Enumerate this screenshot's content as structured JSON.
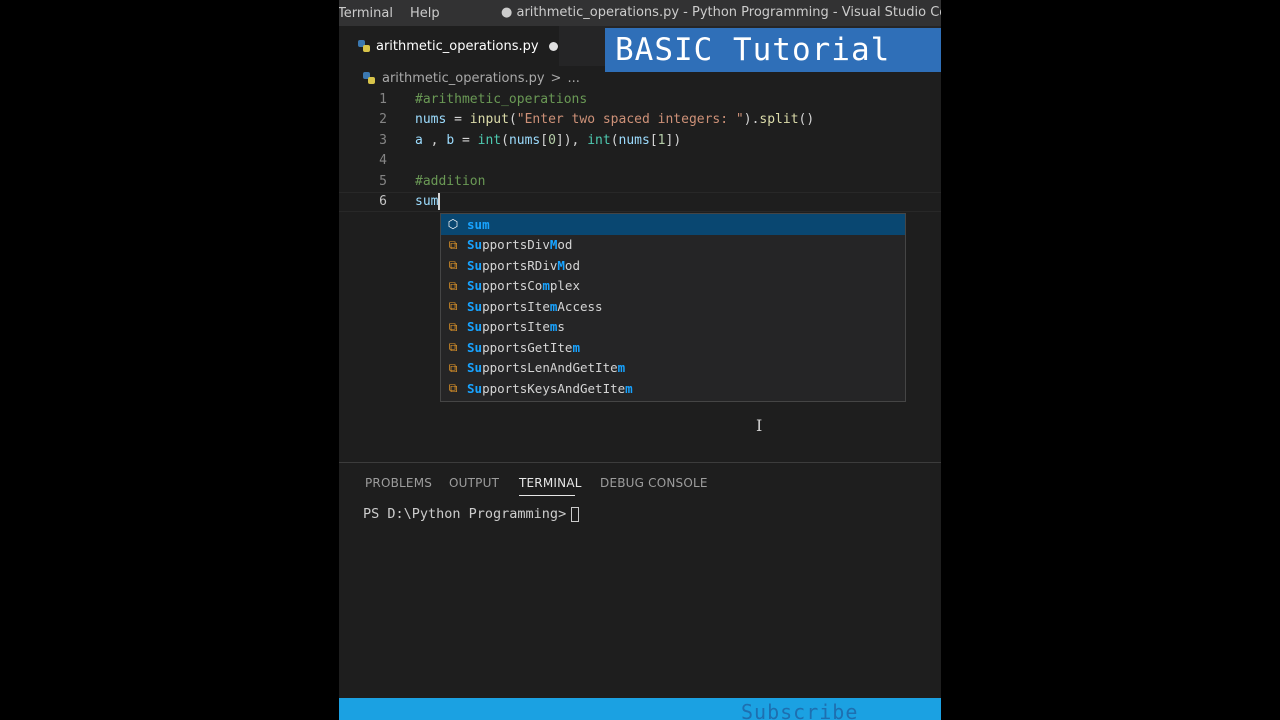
{
  "titlebar": {
    "menu_terminal": "Terminal",
    "menu_help": "Help",
    "window_title": "● arithmetic_operations.py - Python Programming - Visual Studio Code"
  },
  "tab": {
    "filename": "arithmetic_operations.py",
    "icon": "python-file-icon",
    "modified": true
  },
  "banner": {
    "text": "BASIC Tutorial"
  },
  "breadcrumb": {
    "file": "arithmetic_operations.py",
    "separator": ">",
    "more": "..."
  },
  "editor": {
    "lines": [
      {
        "num": "1",
        "tokens": [
          {
            "t": "#arithmetic_operations",
            "c": "c-comment"
          }
        ]
      },
      {
        "num": "2",
        "tokens": [
          {
            "t": "nums",
            "c": "c-var"
          },
          {
            "t": " = ",
            "c": ""
          },
          {
            "t": "input",
            "c": "c-fn"
          },
          {
            "t": "(",
            "c": ""
          },
          {
            "t": "\"Enter two spaced integers: \"",
            "c": "c-str"
          },
          {
            "t": ").",
            "c": ""
          },
          {
            "t": "split",
            "c": "c-fn"
          },
          {
            "t": "()",
            "c": ""
          }
        ]
      },
      {
        "num": "3",
        "tokens": [
          {
            "t": "a",
            "c": "c-var"
          },
          {
            "t": " , ",
            "c": ""
          },
          {
            "t": "b",
            "c": "c-var"
          },
          {
            "t": " = ",
            "c": ""
          },
          {
            "t": "int",
            "c": "c-cls"
          },
          {
            "t": "(",
            "c": ""
          },
          {
            "t": "nums",
            "c": "c-var"
          },
          {
            "t": "[",
            "c": ""
          },
          {
            "t": "0",
            "c": "c-num"
          },
          {
            "t": "]), ",
            "c": ""
          },
          {
            "t": "int",
            "c": "c-cls"
          },
          {
            "t": "(",
            "c": ""
          },
          {
            "t": "nums",
            "c": "c-var"
          },
          {
            "t": "[",
            "c": ""
          },
          {
            "t": "1",
            "c": "c-num"
          },
          {
            "t": "])",
            "c": ""
          }
        ]
      },
      {
        "num": "4",
        "tokens": []
      },
      {
        "num": "5",
        "tokens": [
          {
            "t": "#addition",
            "c": "c-comment"
          }
        ]
      },
      {
        "num": "6",
        "tokens": [
          {
            "t": "sum",
            "c": "c-var"
          }
        ],
        "active": true
      }
    ]
  },
  "suggestions": {
    "query": "sum",
    "items": [
      {
        "label": "sum",
        "icon": "cube-icon",
        "selected": true
      },
      {
        "label": "SupportsDivMod",
        "icon": "class-icon"
      },
      {
        "label": "SupportsRDivMod",
        "icon": "class-icon"
      },
      {
        "label": "SupportsComplex",
        "icon": "class-icon"
      },
      {
        "label": "SupportsItemAccess",
        "icon": "class-icon"
      },
      {
        "label": "SupportsItems",
        "icon": "class-icon"
      },
      {
        "label": "SupportsGetItem",
        "icon": "class-icon"
      },
      {
        "label": "SupportsLenAndGetItem",
        "icon": "class-icon"
      },
      {
        "label": "SupportsKeysAndGetItem",
        "icon": "class-icon"
      }
    ]
  },
  "panel": {
    "tabs": [
      "PROBLEMS",
      "OUTPUT",
      "TERMINAL",
      "DEBUG CONSOLE"
    ],
    "active_tab": "TERMINAL",
    "terminal_prompt": "PS D:\\Python Programming>"
  },
  "statusbar": {
    "subscribe_text": "Subscribe"
  },
  "colors": {
    "editor_bg": "#1e1e1e",
    "statusbar_bg": "#1ba1e2",
    "banner_bg": "#2f6fb8",
    "suggest_selected": "#094771"
  }
}
